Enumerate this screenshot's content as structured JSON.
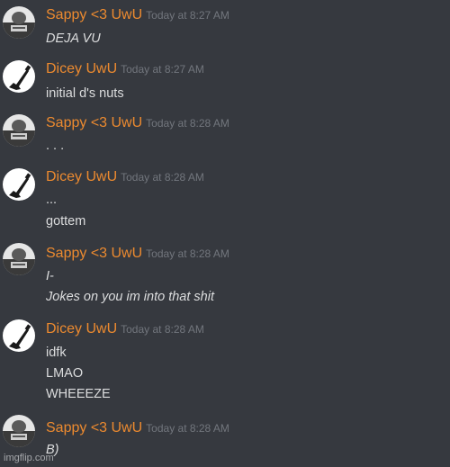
{
  "messages": [
    {
      "author": "Sappy <3 UwU",
      "avatar_icon": "sappy-avatar-icon",
      "timestamp": "Today at 8:27 AM",
      "lines": [
        "DEJA VU"
      ],
      "italic": true
    },
    {
      "author": "Dicey UwU",
      "avatar_icon": "guitar-avatar-icon",
      "timestamp": "Today at 8:27 AM",
      "lines": [
        "initial d's nuts"
      ],
      "italic": false
    },
    {
      "author": "Sappy <3 UwU",
      "avatar_icon": "sappy-avatar-icon",
      "timestamp": "Today at 8:28 AM",
      "lines": [
        ". . ."
      ],
      "italic": false
    },
    {
      "author": "Dicey UwU",
      "avatar_icon": "guitar-avatar-icon",
      "timestamp": "Today at 8:28 AM",
      "lines": [
        "...",
        "gottem"
      ],
      "italic": false
    },
    {
      "author": "Sappy <3 UwU",
      "avatar_icon": "sappy-avatar-icon",
      "timestamp": "Today at 8:28 AM",
      "lines": [
        "I-",
        "Jokes on you im into that shit"
      ],
      "italic": true
    },
    {
      "author": "Dicey UwU",
      "avatar_icon": "guitar-avatar-icon",
      "timestamp": "Today at 8:28 AM",
      "lines": [
        "idfk",
        "LMAO",
        "WHEEEZE"
      ],
      "italic": false
    },
    {
      "author": "Sappy <3 UwU",
      "avatar_icon": "sappy-avatar-icon",
      "timestamp": "Today at 8:28 AM",
      "lines": [
        "B)"
      ],
      "italic": true
    }
  ],
  "watermark": "imgflip.com",
  "colors": {
    "background": "#36393f",
    "username": "#ec8a2f",
    "timestamp": "#72767d",
    "message_text": "#dcddde"
  }
}
